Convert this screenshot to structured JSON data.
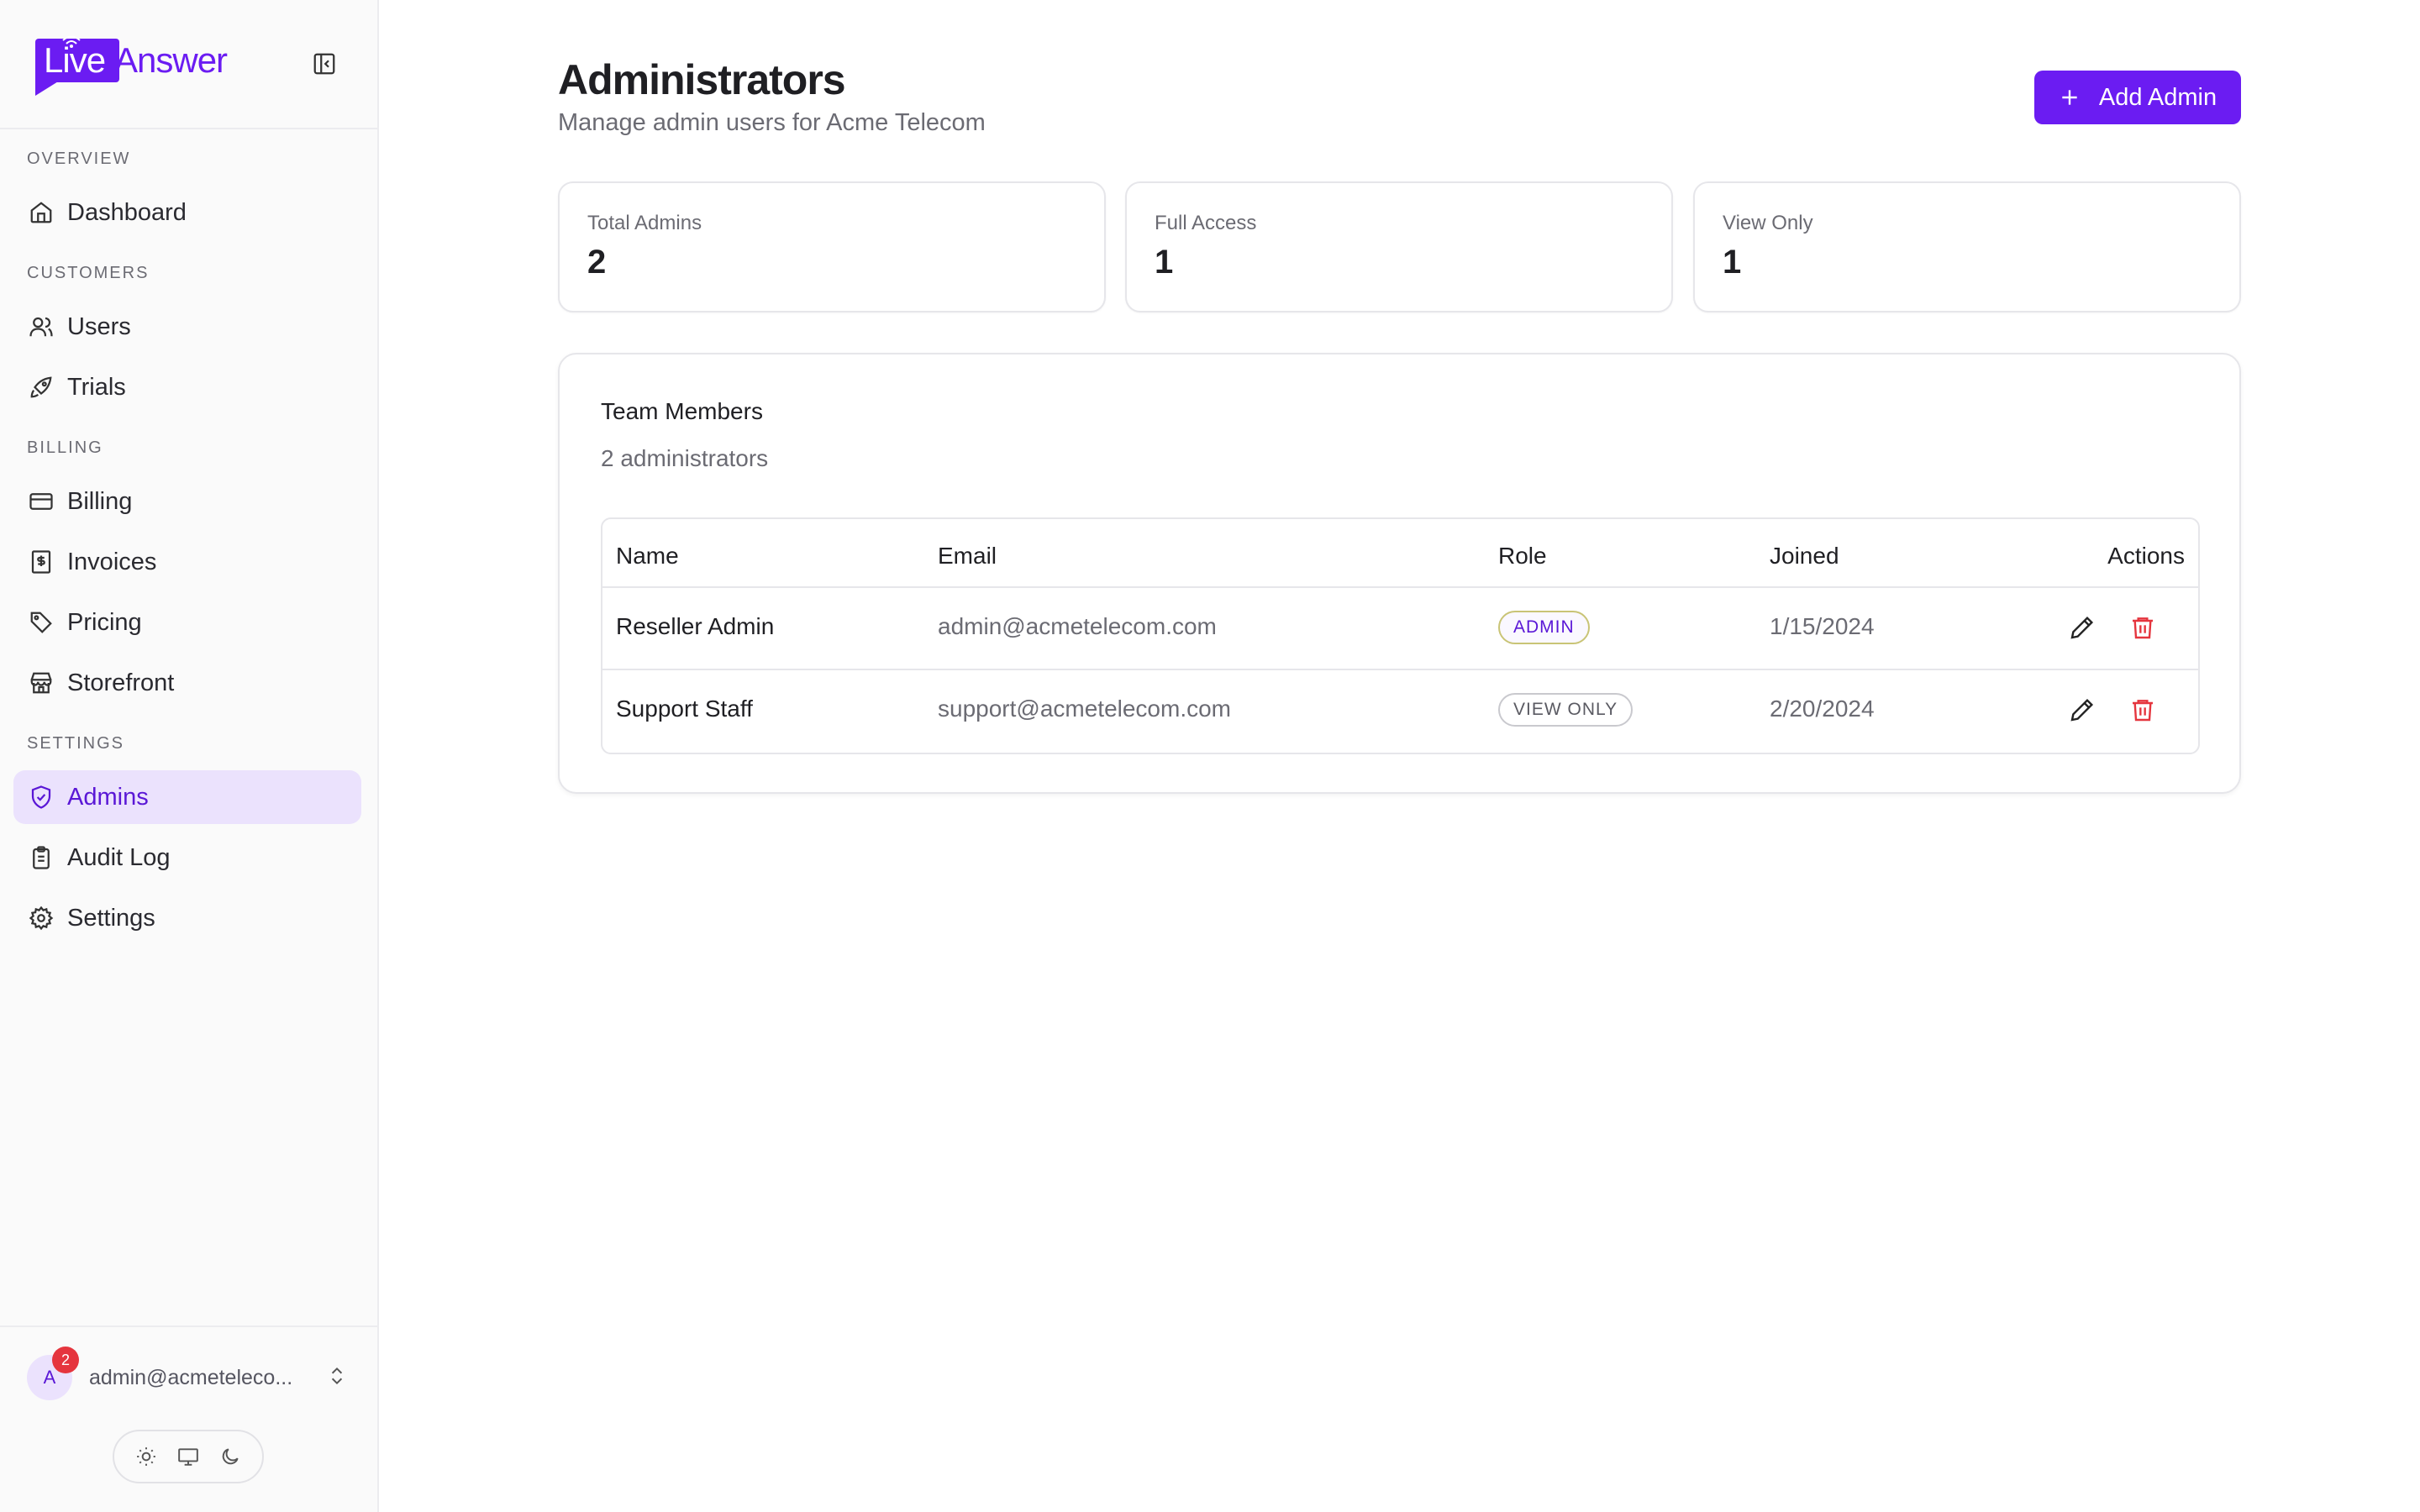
{
  "brand": {
    "part1": "Live",
    "part2": "Answer",
    "accent": "#6b1cf2"
  },
  "sidebar": {
    "sections": [
      {
        "label": "OVERVIEW"
      },
      {
        "label": "CUSTOMERS"
      },
      {
        "label": "BILLING"
      },
      {
        "label": "SETTINGS"
      }
    ],
    "items": [
      {
        "label": "Dashboard",
        "icon": "home-icon"
      },
      {
        "label": "Users",
        "icon": "users-icon"
      },
      {
        "label": "Trials",
        "icon": "rocket-icon"
      },
      {
        "label": "Billing",
        "icon": "credit-card-icon"
      },
      {
        "label": "Invoices",
        "icon": "receipt-icon"
      },
      {
        "label": "Pricing",
        "icon": "tag-icon"
      },
      {
        "label": "Storefront",
        "icon": "store-icon"
      },
      {
        "label": "Admins",
        "icon": "shield-icon",
        "active": true
      },
      {
        "label": "Audit Log",
        "icon": "clipboard-icon"
      },
      {
        "label": "Settings",
        "icon": "gear-icon"
      }
    ],
    "user": {
      "initial": "A",
      "notifications": "2",
      "email": "admin@acmeteleco..."
    }
  },
  "header": {
    "title": "Administrators",
    "subtitle": "Manage admin users for Acme Telecom",
    "add_button": "Add Admin"
  },
  "stats": [
    {
      "label": "Total Admins",
      "value": "2"
    },
    {
      "label": "Full Access",
      "value": "1"
    },
    {
      "label": "View Only",
      "value": "1"
    }
  ],
  "team": {
    "title": "Team Members",
    "subtitle": "2 administrators",
    "columns": [
      "Name",
      "Email",
      "Role",
      "Joined",
      "Actions"
    ],
    "rows": [
      {
        "name": "Reseller Admin",
        "email": "admin@acmetelecom.com",
        "role": "ADMIN",
        "joined": "1/15/2024"
      },
      {
        "name": "Support Staff",
        "email": "support@acmetelecom.com",
        "role": "VIEW ONLY",
        "joined": "2/20/2024"
      }
    ]
  },
  "colors": {
    "danger": "#e5353e",
    "active_bg": "#ebe2fd",
    "active_text": "#5a17d6"
  }
}
